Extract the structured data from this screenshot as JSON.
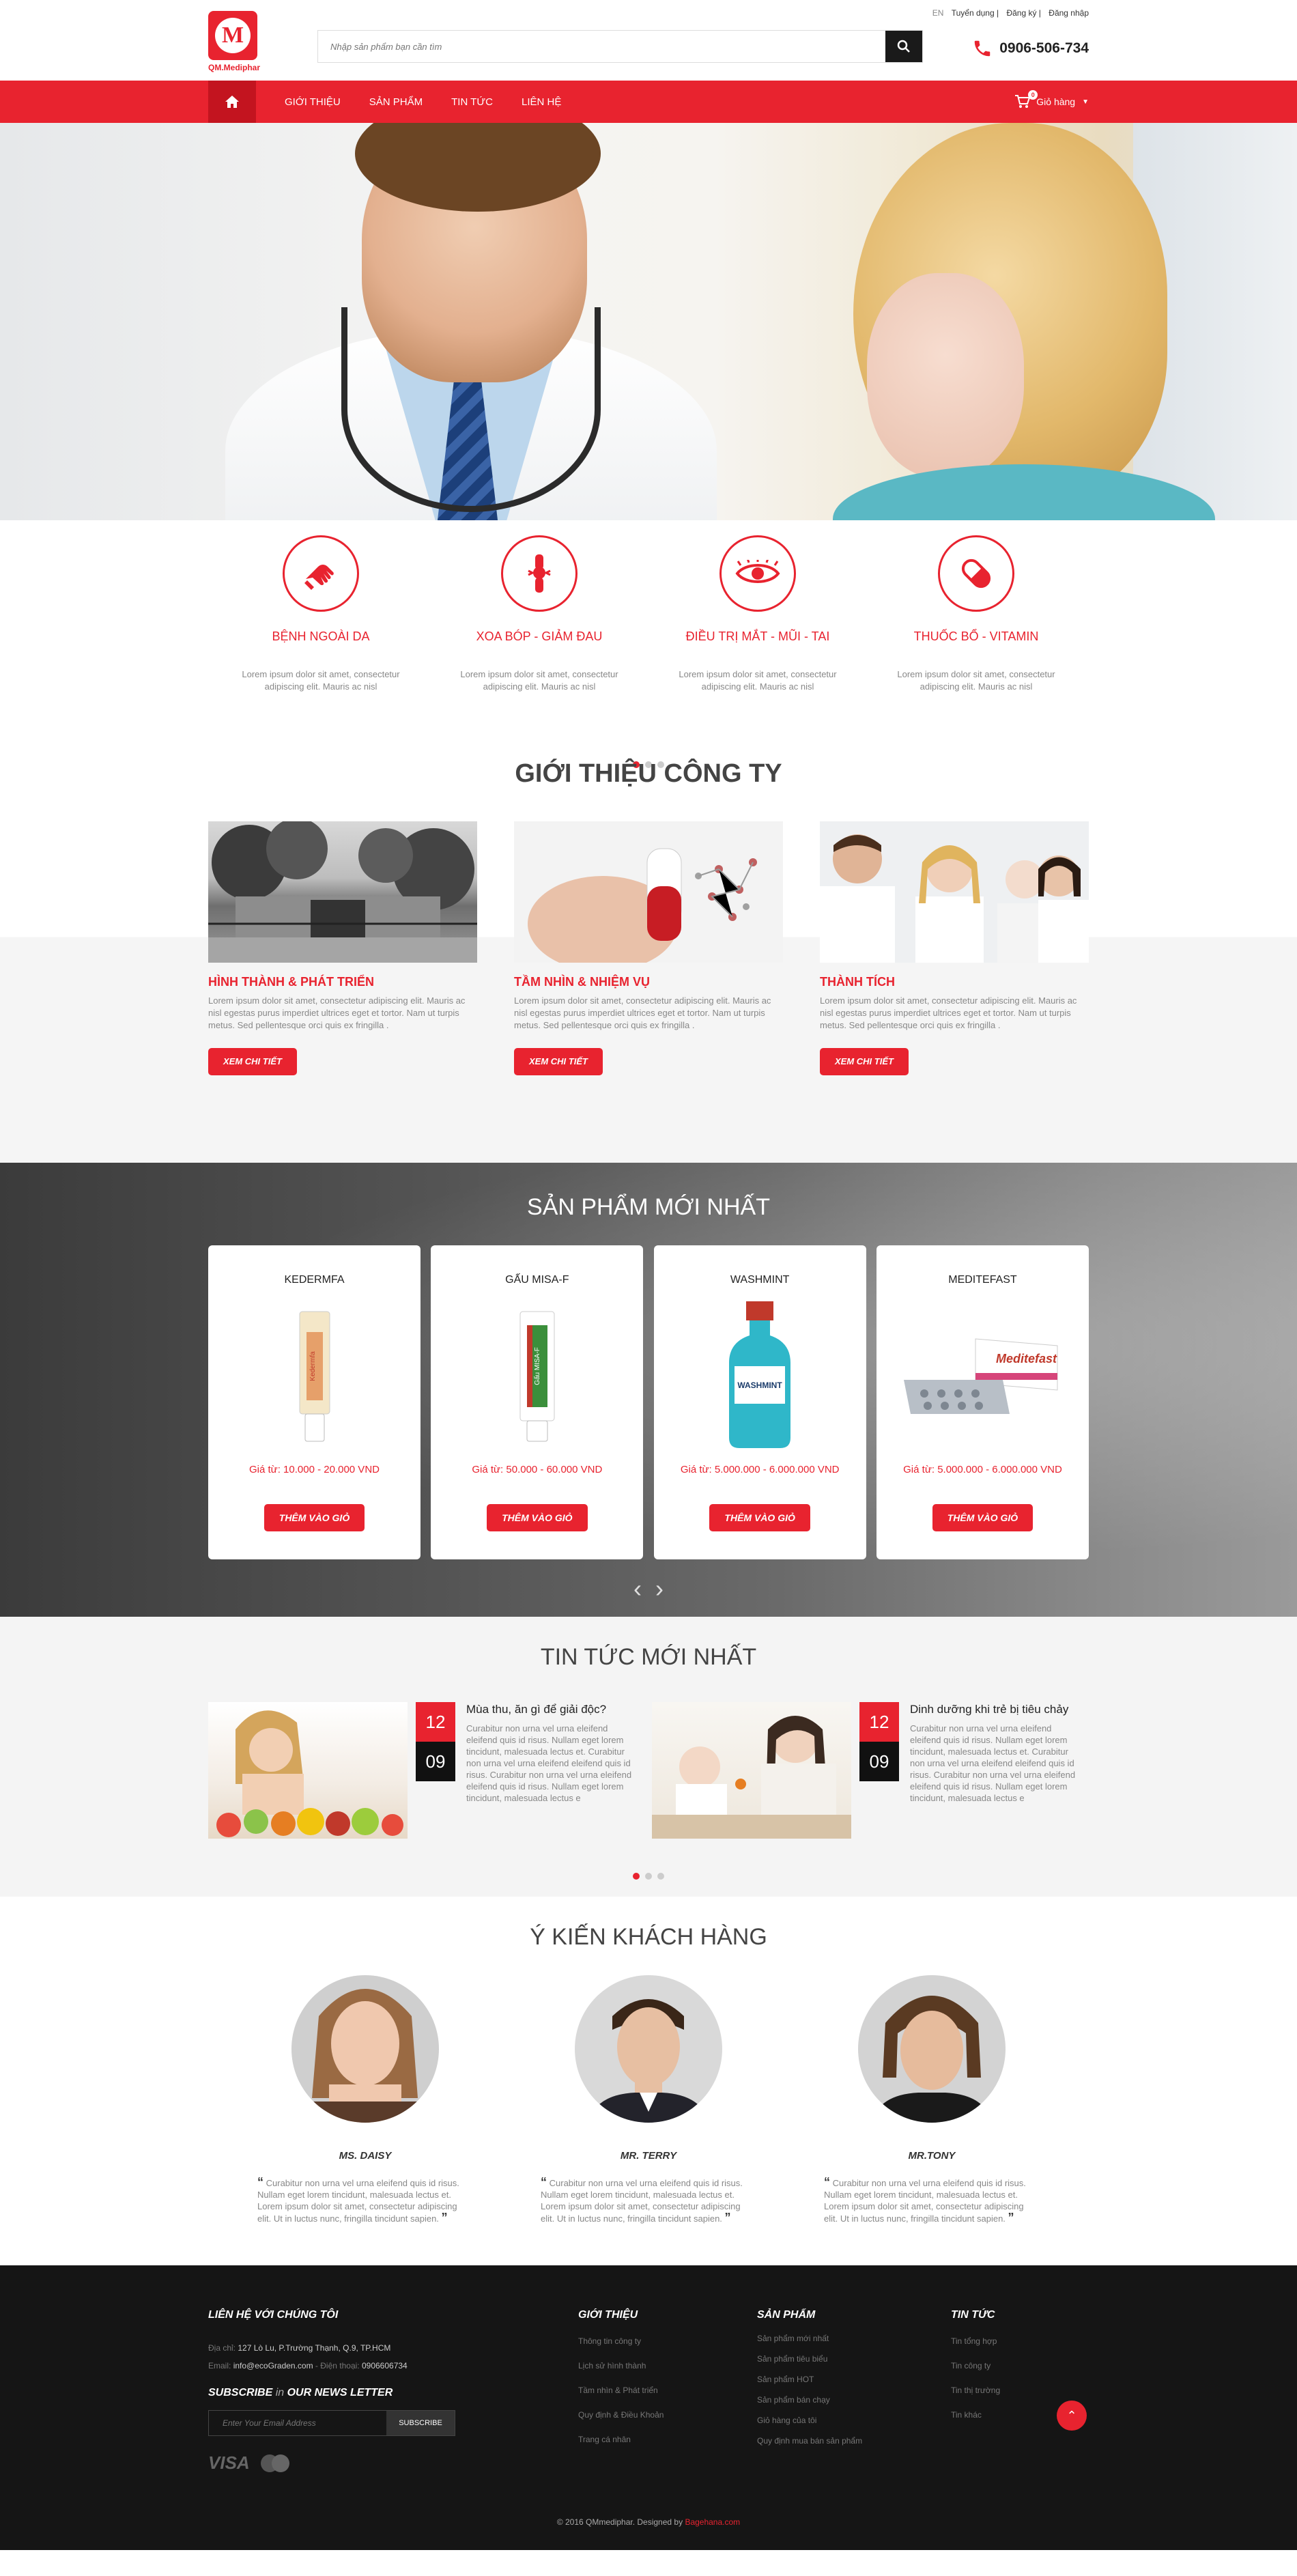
{
  "header": {
    "logo_text": "QM.Mediphar",
    "search_placeholder": "Nhập sản phẩm bạn cần tìm",
    "lang": "EN",
    "links": [
      "Tuyển dụng |",
      "Đăng ký |",
      "Đăng nhập"
    ],
    "hotline": "0906-506-734"
  },
  "nav": {
    "items": [
      "GIỚI THIỆU",
      "SẢN PHẨM",
      "TIN TỨC",
      "LIÊN HỆ"
    ],
    "cart_label": "Giỏ hàng",
    "cart_count": "0"
  },
  "services": [
    {
      "title": "BỆNH NGOÀI DA",
      "desc": "Lorem ipsum dolor sit amet, consectetur adipiscing elit. Mauris ac nisl",
      "icon": "hands-icon"
    },
    {
      "title": "XOA BÓP - GIẢM ĐAU",
      "desc": "Lorem ipsum dolor sit amet, consectetur adipiscing elit. Mauris ac nisl",
      "icon": "joint-icon"
    },
    {
      "title": "ĐIỀU TRỊ MẮT - MŨI - TAI",
      "desc": "Lorem ipsum dolor sit amet, consectetur adipiscing elit. Mauris ac nisl",
      "icon": "eye-icon"
    },
    {
      "title": "THUỐC BỔ - VITAMIN",
      "desc": "Lorem ipsum dolor sit amet, consectetur adipiscing elit. Mauris ac nisl",
      "icon": "pill-icon"
    }
  ],
  "about": {
    "title": "GIỚI THIỆU CÔNG TY",
    "cards": [
      {
        "title": "HÌNH THÀNH & PHÁT TRIỂN",
        "desc": "Lorem ipsum dolor sit amet, consectetur adipiscing elit. Mauris ac nisl egestas purus imperdiet ultrices eget et tortor. Nam ut turpis metus. Sed pellentesque orci quis ex fringilla .",
        "button": "XEM CHI TIẾT"
      },
      {
        "title": "TẦM NHÌN & NHIỆM VỤ",
        "desc": "Lorem ipsum dolor sit amet, consectetur adipiscing elit. Mauris ac nisl egestas purus imperdiet ultrices eget et tortor. Nam ut turpis metus. Sed pellentesque orci quis ex fringilla .",
        "button": "XEM CHI TIẾT"
      },
      {
        "title": "THÀNH TÍCH",
        "desc": "Lorem ipsum dolor sit amet, consectetur adipiscing elit. Mauris ac nisl egestas purus imperdiet ultrices eget et tortor. Nam ut turpis metus. Sed pellentesque orci quis ex fringilla .",
        "button": "XEM CHI TIẾT"
      }
    ]
  },
  "products": {
    "title": "SẢN PHẨM MỚI NHẤT",
    "items": [
      {
        "name": "KEDERMFA",
        "price": "Giá từ: 10.000 - 20.000 VND",
        "button": "THÊM VÀO GIỎ"
      },
      {
        "name": "GẤU MISA-F",
        "price": "Giá từ: 50.000 - 60.000 VND",
        "button": "THÊM VÀO GIỎ"
      },
      {
        "name": "WASHMINT",
        "price": "Giá từ: 5.000.000 - 6.000.000 VND",
        "button": "THÊM VÀO GIỎ"
      },
      {
        "name": "MEDITEFAST",
        "price": "Giá từ: 5.000.000 - 6.000.000 VND",
        "button": "THÊM VÀO GIỎ"
      }
    ]
  },
  "news": {
    "title": "TIN TỨC MỚI NHẤT",
    "items": [
      {
        "month": "12",
        "day": "09",
        "title": "Mùa thu, ăn gì để giải độc?",
        "desc": "Curabitur non urna vel urna eleifend eleifend quis id risus. Nullam eget lorem tincidunt, malesuada lectus et. Curabitur non urna vel urna eleifend eleifend quis id risus. Curabitur non urna vel urna eleifend eleifend quis id risus. Nullam eget lorem tincidunt, malesuada lectus e"
      },
      {
        "month": "12",
        "day": "09",
        "title": "Dinh dưỡng khi trẻ bị tiêu chảy",
        "desc": "Curabitur non urna vel urna eleifend eleifend quis id risus. Nullam eget lorem tincidunt, malesuada lectus et. Curabitur non urna vel urna eleifend eleifend quis id risus. Curabitur non urna vel urna eleifend eleifend quis id risus. Nullam eget lorem tincidunt, malesuada lectus e"
      }
    ]
  },
  "testimonials": {
    "title": "Ý KIẾN KHÁCH HÀNG",
    "items": [
      {
        "name": "MS. DAISY",
        "quote": "Curabitur non urna vel urna eleifend quis id risus. Nullam eget lorem tincidunt, malesuada lectus et. Lorem ipsum dolor sit amet, consectetur adipiscing elit. Ut in luctus nunc, fringilla tincidunt sapien."
      },
      {
        "name": "MR. TERRY",
        "quote": "Curabitur non urna vel urna eleifend quis id risus. Nullam eget lorem tincidunt, malesuada lectus et. Lorem ipsum dolor sit amet, consectetur adipiscing elit. Ut in luctus nunc, fringilla tincidunt sapien."
      },
      {
        "name": "MR.TONY",
        "quote": "Curabitur non urna vel urna eleifend quis id risus. Nullam eget lorem tincidunt, malesuada lectus et. Lorem ipsum dolor sit amet, consectetur adipiscing elit. Ut in luctus nunc, fringilla tincidunt sapien."
      }
    ]
  },
  "footer": {
    "contact_title": "LIÊN HỆ VỚI CHÚNG TÔI",
    "address_label": "Địa chỉ:",
    "address": "127 Lò Lu, P.Trường Thạnh, Q.9, TP.HCM",
    "email_label": "Email:",
    "email": "info@ecoGraden.com",
    "phone_label": "Điện thoại:",
    "phone": "0906606734",
    "subscribe": "SUBSCRIBE",
    "subscribe_in": "in",
    "subscribe_news": "OUR NEWS LETTER",
    "email_placeholder": "Enter Your Email Address",
    "subscribe_button": "SUBSCRIBE",
    "visa": "VISA",
    "cols": [
      {
        "title": "GIỚI THIỆU",
        "links": [
          "Thông tin công ty",
          "Lịch sử hình thành",
          "Tầm nhìn & Phát triển",
          "Quy định & Điều Khoản",
          "Trang cá nhân"
        ]
      },
      {
        "title": "SẢN PHẨM",
        "links": [
          "Sản phẩm mới nhất",
          "Sản phẩm tiêu biểu",
          "Sản phẩm HOT",
          "Sản phẩm bán chạy",
          "Giỏ hàng của tôi",
          "Quy định mua bán sản phẩm"
        ]
      },
      {
        "title": "TIN TỨC",
        "links": [
          "Tin tổng hợp",
          "Tin công ty",
          "Tin thị trường",
          "Tin khác"
        ]
      }
    ],
    "copyright": "© 2016 QMmediphar. Designed by",
    "designer": "Bagehana.com"
  }
}
